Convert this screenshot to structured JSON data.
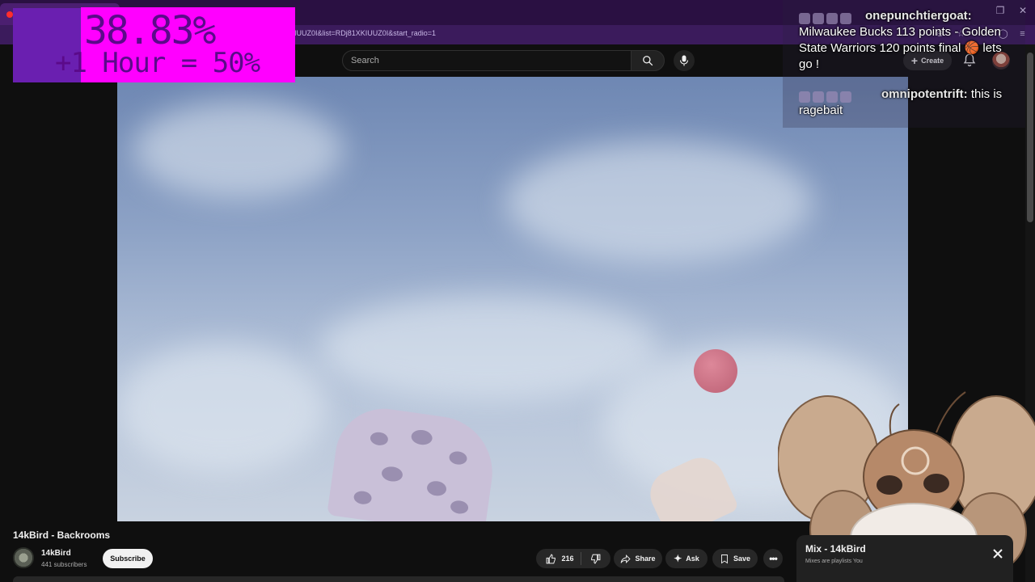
{
  "browser": {
    "url": "IUUZ0I&list=RDj81XKIUUZ0I&start_radio=1"
  },
  "header": {
    "search_placeholder": "Search",
    "create_label": "Create"
  },
  "overlay": {
    "stat_line1": "38.83%",
    "stat_line2": "+1 Hour = 50%",
    "chat": [
      {
        "user": "onepunchtiergoat:",
        "message": "Milwaukee Bucks 113 points - Golden State Warriors 120 points final 🏀 lets go !"
      },
      {
        "user": "omnipotentrift:",
        "message": "this is ragebait"
      }
    ]
  },
  "video": {
    "title": "14kBird - Backrooms"
  },
  "channel": {
    "name": "14kBird",
    "subscribers": "441 subscribers",
    "subscribe_label": "Subscribe"
  },
  "actions": {
    "likes": "216",
    "share_label": "Share",
    "ask_label": "Ask",
    "save_label": "Save"
  },
  "mix": {
    "title": "Mix - 14kBird",
    "subtitle": "Mixes are playlists You"
  },
  "colors": {
    "stat_box": "#ff00ff",
    "stat_text": "#5b0a8a",
    "browser_frame": "#2a1042"
  }
}
